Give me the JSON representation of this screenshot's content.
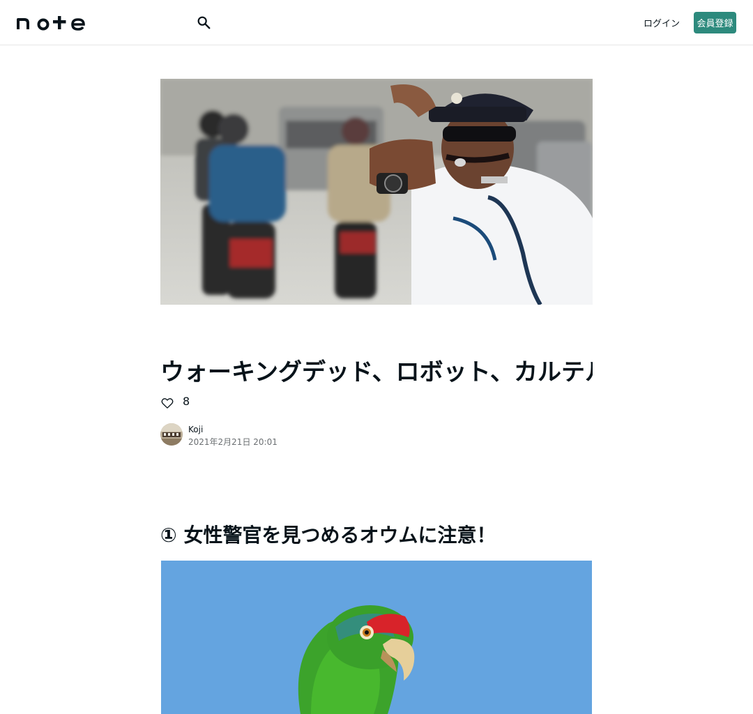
{
  "header": {
    "logo_text": "note",
    "search_icon": "search-icon",
    "login_label": "ログイン",
    "signup_label": "会員登録"
  },
  "article": {
    "hero_image": "traffic-officer-photo",
    "title": "ウォーキングデッド、ロボット、カルテル…インドの交通整理が個性的",
    "like_icon": "heart-outline-icon",
    "like_count": "8",
    "author": {
      "name": "Koji",
      "date": "2021年2月21日 20:01"
    },
    "section_heading": "① 女性警官を見つめるオウムに注意！",
    "section_image": "parrot-photo"
  },
  "colors": {
    "accent": "#2d8a7d",
    "text": "#08131a",
    "muted": "#6b6f72",
    "border": "#e6e6e6"
  }
}
